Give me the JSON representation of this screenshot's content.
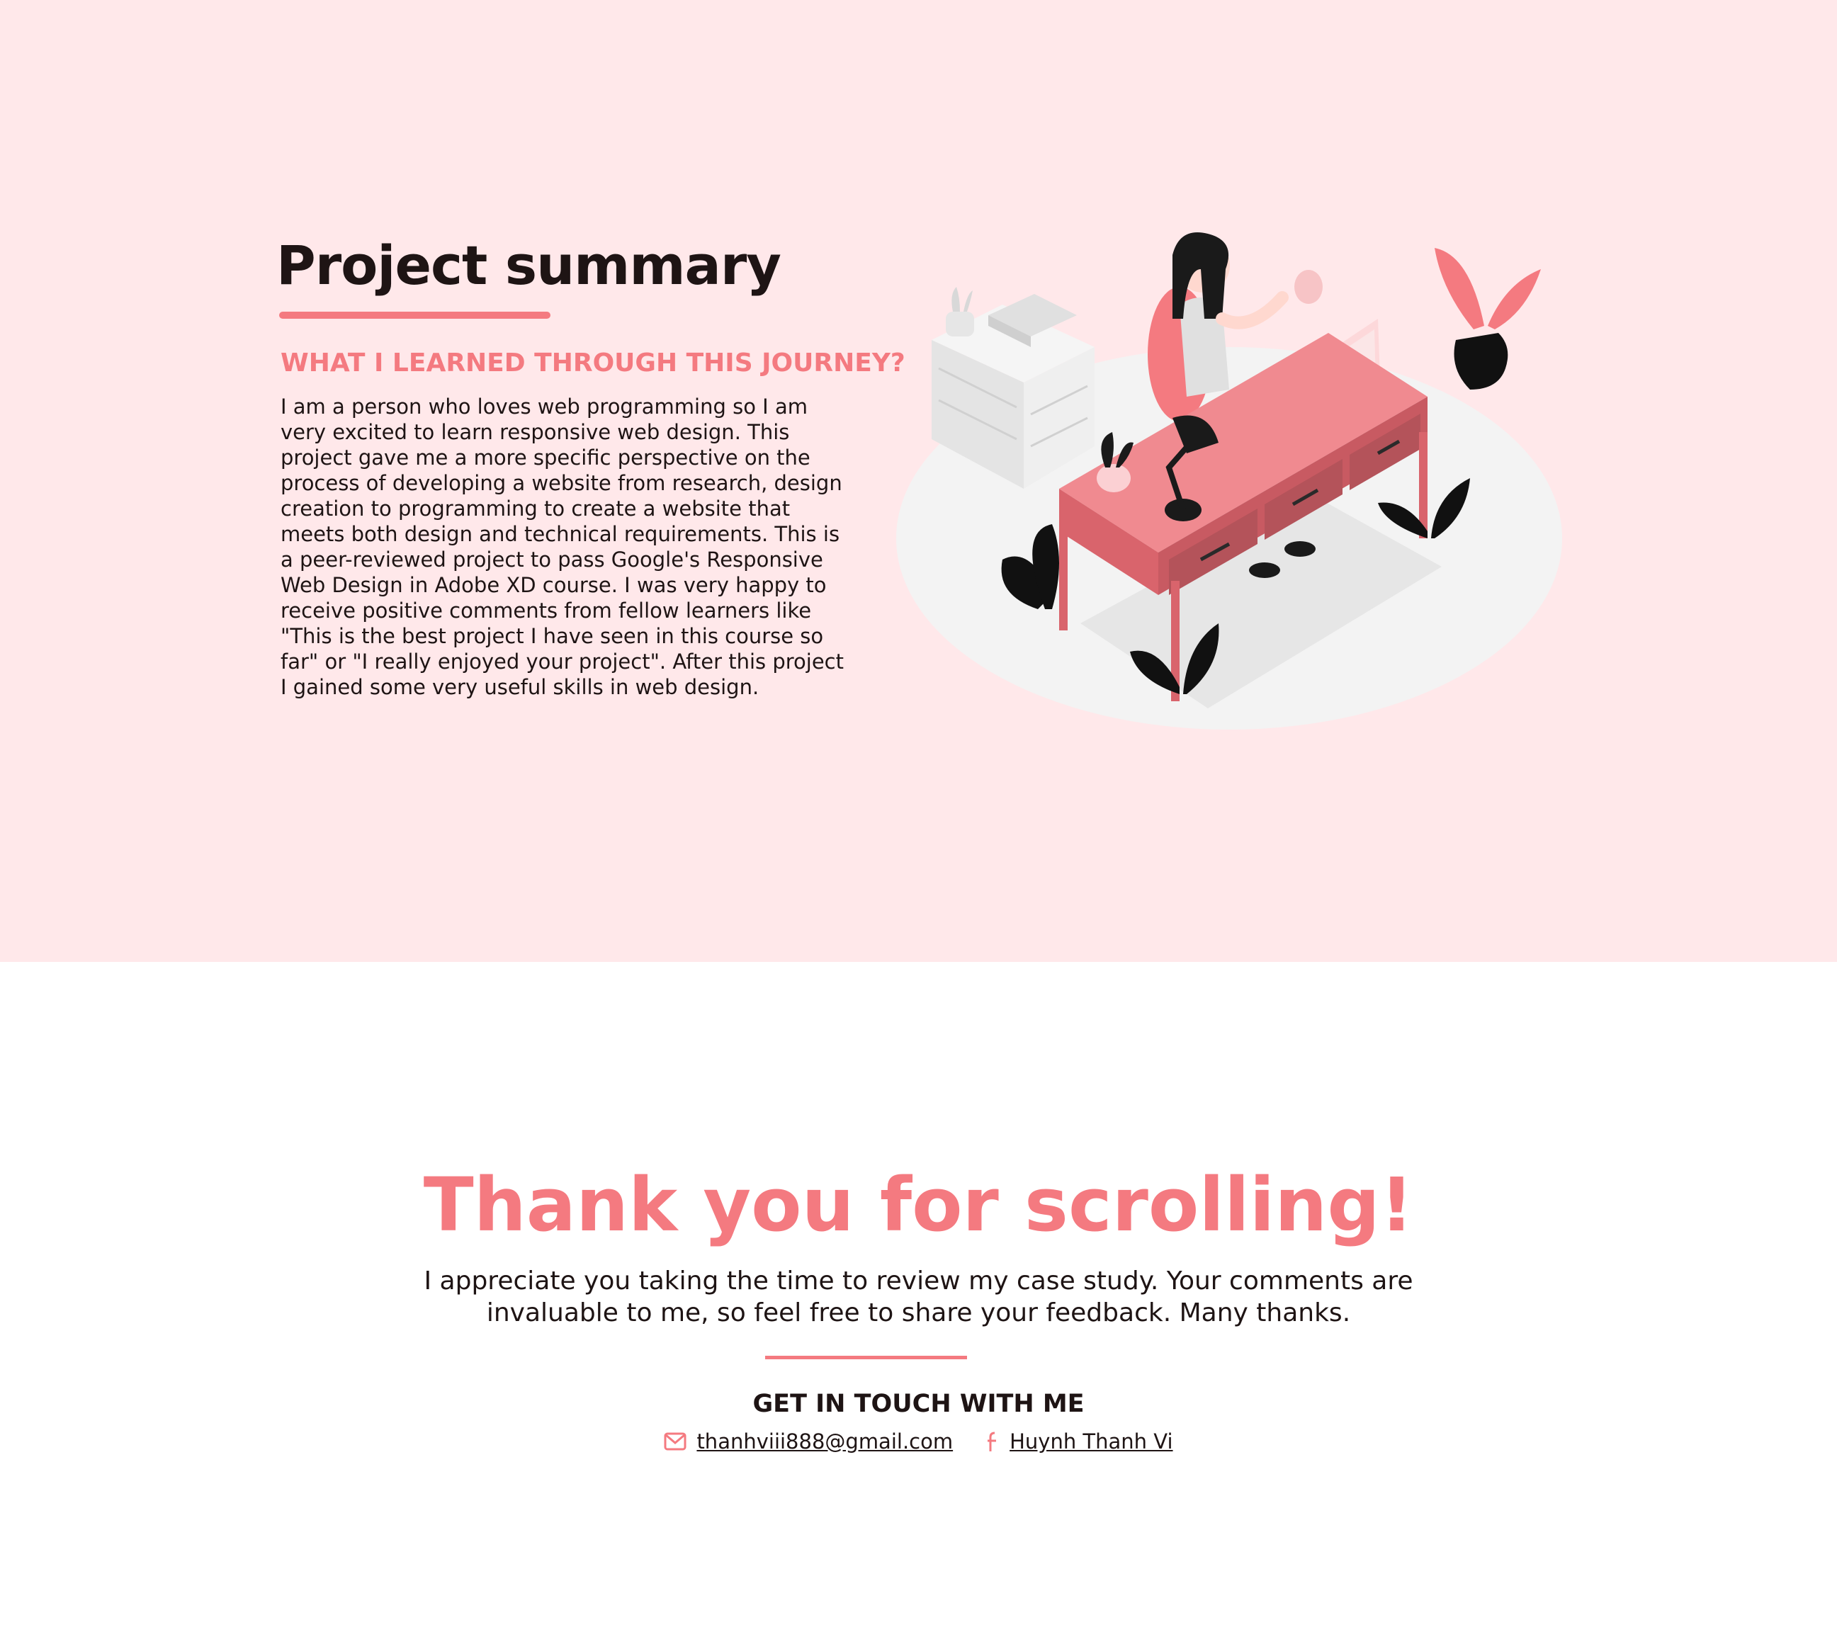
{
  "colors": {
    "accent": "#f47a80",
    "background_pink": "#ffe8ea",
    "text": "#1e1414"
  },
  "summary": {
    "title": "Project summary",
    "subtitle": "WHAT I LEARNED THROUGH THIS JOURNEY?",
    "body": "I am a person who loves web programming so I am very excited to learn responsive web design. This project gave me a more specific perspective on the process of developing a website from research, design creation to programming to create a website that meets both design and technical requirements. This is a peer-reviewed project to pass Google's Responsive Web Design in Adobe XD course. I was very happy to receive positive comments from fellow learners like \"This is the best project I have seen in this course so far\" or \"I really enjoyed your project\". After this project I gained some very useful skills in web design."
  },
  "thanks": {
    "title": "Thank you for scrolling!",
    "body": "I appreciate you taking the time to review my case study. Your comments are invaluable to me, so feel free to share your feedback. Many thanks."
  },
  "contact": {
    "title": "GET IN TOUCH WITH ME",
    "email": {
      "icon": "mail-icon",
      "label": "thanhviii888@gmail.com"
    },
    "facebook": {
      "icon": "facebook-icon",
      "label": "Huynh Thanh Vi"
    }
  }
}
